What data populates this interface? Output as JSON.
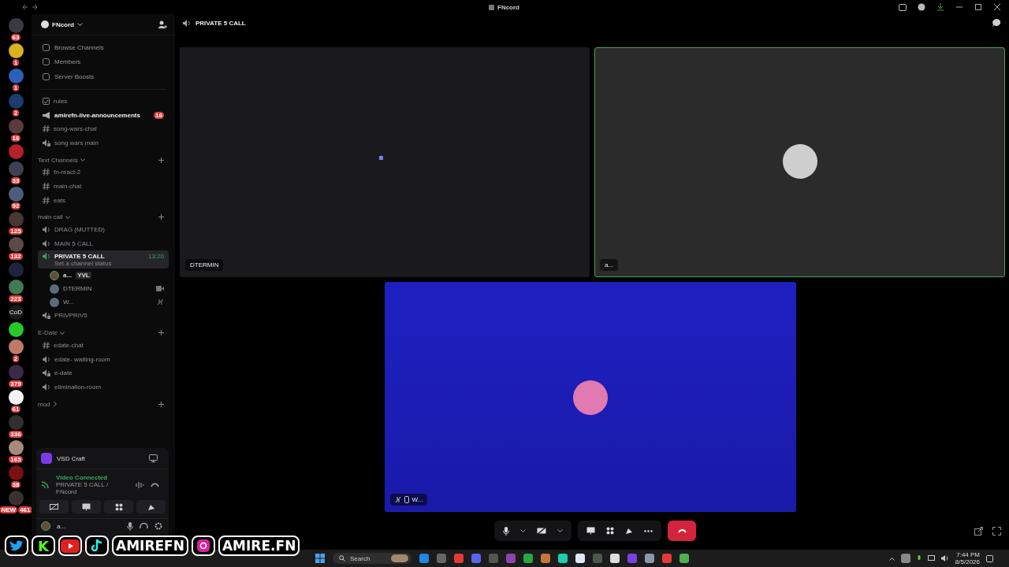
{
  "title_bar": {
    "title": "FNcord"
  },
  "servers": [
    {
      "badge": "63",
      "color": "#3a3b40"
    },
    {
      "badge": "1",
      "color": "#d8b11c"
    },
    {
      "badge": "1",
      "color": "#2b5fb8"
    },
    {
      "badge": "2",
      "color": "#1d3c6e"
    },
    {
      "badge": "16",
      "color": "#5a3a3a"
    },
    {
      "color": "#b5202a"
    },
    {
      "badge": "33",
      "color": "#3d4250"
    },
    {
      "badge": "92",
      "color": "#4b5d7a"
    },
    {
      "badge": "125",
      "color": "#4a3634"
    },
    {
      "badge": "132",
      "color": "#5c4a4a"
    },
    {
      "color": "#1e2440"
    },
    {
      "badge": "223",
      "color": "#3f7a52"
    },
    {
      "color": "#1a1a1c",
      "label": "CoD"
    },
    {
      "color": "#28c828"
    },
    {
      "badge": "2",
      "color": "#c07a6a"
    },
    {
      "badge": "379",
      "color": "#3a2a4a"
    },
    {
      "badge": "61",
      "color": "#f2f2f2"
    },
    {
      "badge": "336",
      "color": "#303030"
    },
    {
      "badge": "165",
      "color": "#a88a7a"
    },
    {
      "badge": "38",
      "color": "#7a1010"
    },
    {
      "badge": "461",
      "color": "#3a3030",
      "new": "NEW"
    }
  ],
  "sidebar": {
    "server_name": "FNcord",
    "nav": [
      {
        "label": "Browse Channels"
      },
      {
        "label": "Members"
      },
      {
        "label": "Server Boosts"
      }
    ],
    "groups": [
      {
        "channels": [
          {
            "kind": "rules",
            "name": "rules",
            "unread": false,
            "selected": false
          },
          {
            "kind": "announcement",
            "name": "amirefn-live-announcements",
            "unread": true,
            "badge": "16",
            "selected": false
          },
          {
            "kind": "text",
            "name": "song-wars-chat",
            "unread": false,
            "selected": false
          },
          {
            "kind": "voice-locked",
            "name": "song wars main",
            "unread": false,
            "selected": false
          }
        ]
      },
      {
        "category": "Text Channels",
        "collapsed": false,
        "channels": [
          {
            "kind": "text",
            "name": "fn-react-2",
            "unread": false,
            "selected": false
          },
          {
            "kind": "text",
            "name": "main-chat",
            "unread": false,
            "selected": false
          },
          {
            "kind": "text",
            "name": "eats",
            "unread": false,
            "selected": false
          }
        ]
      },
      {
        "category": "main call",
        "collapsed": false,
        "channels": [
          {
            "kind": "voice",
            "name": "DRAG (MUTTED)",
            "unread": false,
            "selected": false
          },
          {
            "kind": "voice",
            "name": "MAIN 5 CALL",
            "unread": false,
            "selected": false
          },
          {
            "kind": "voice",
            "name": "PRIVATE 5 CALL",
            "unread": true,
            "selected": true,
            "time": "13:20",
            "status": "Set a channel status",
            "members": [
              {
                "name": "a...",
                "tag": "YVL",
                "speaking": true,
                "video": false,
                "muted": false
              },
              {
                "name": "DTERMIN",
                "speaking": false,
                "video": true,
                "muted": false
              },
              {
                "name": "W...",
                "speaking": false,
                "video": false,
                "muted": true
              }
            ]
          },
          {
            "kind": "voice-locked",
            "name": "PRIVPRIV5",
            "unread": false,
            "selected": false
          }
        ]
      },
      {
        "category": "E-Date",
        "collapsed": false,
        "channels": [
          {
            "kind": "text",
            "name": "edate-chat",
            "unread": false,
            "selected": false
          },
          {
            "kind": "voice",
            "name": "edate- waiting-room",
            "unread": false,
            "selected": false
          },
          {
            "kind": "voice-locked",
            "name": "e-date",
            "unread": false,
            "selected": false
          },
          {
            "kind": "voice",
            "name": "elimination-room",
            "unread": false,
            "selected": false
          }
        ]
      },
      {
        "category": "mod",
        "collapsed": true
      }
    ]
  },
  "activity": {
    "name": "VSD Craft"
  },
  "voice_panel": {
    "status": "Video Connected",
    "location": "PRIVATE 5 CALL / FNcord"
  },
  "user_panel": {
    "name": "a..."
  },
  "header": {
    "title": "PRIVATE 5 CALL"
  },
  "tiles": [
    {
      "kind": "empty",
      "name": "DTERMIN",
      "speaking": false
    },
    {
      "kind": "avatar",
      "name": "a...",
      "speaking": true
    },
    {
      "kind": "blue",
      "name": "W...",
      "speaking": false,
      "muted": true
    }
  ],
  "overlay": {
    "kick": "K",
    "handle": "AMIREFN",
    "instagram": "AMIRE.FN"
  },
  "taskbar": {
    "search": "Search",
    "time": "7:44 PM",
    "date": "8/5/2026"
  }
}
